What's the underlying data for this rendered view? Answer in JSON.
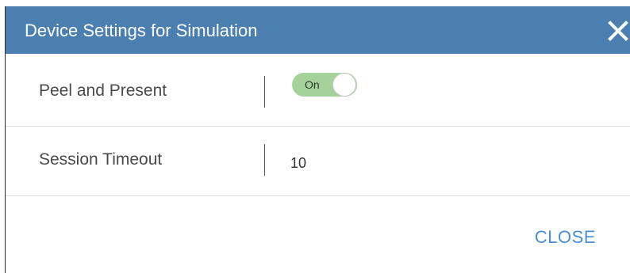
{
  "dialog": {
    "title": "Device Settings for Simulation",
    "close_icon": "close-icon"
  },
  "settings": [
    {
      "label": "Peel and Present",
      "type": "toggle",
      "state": "On",
      "accent": "#a4d29a"
    },
    {
      "label": "Session Timeout",
      "type": "value",
      "value": "10"
    }
  ],
  "footer": {
    "close_label": "CLOSE"
  },
  "colors": {
    "titlebar": "#4a7fb0",
    "close_button": "#4a8fd0"
  }
}
